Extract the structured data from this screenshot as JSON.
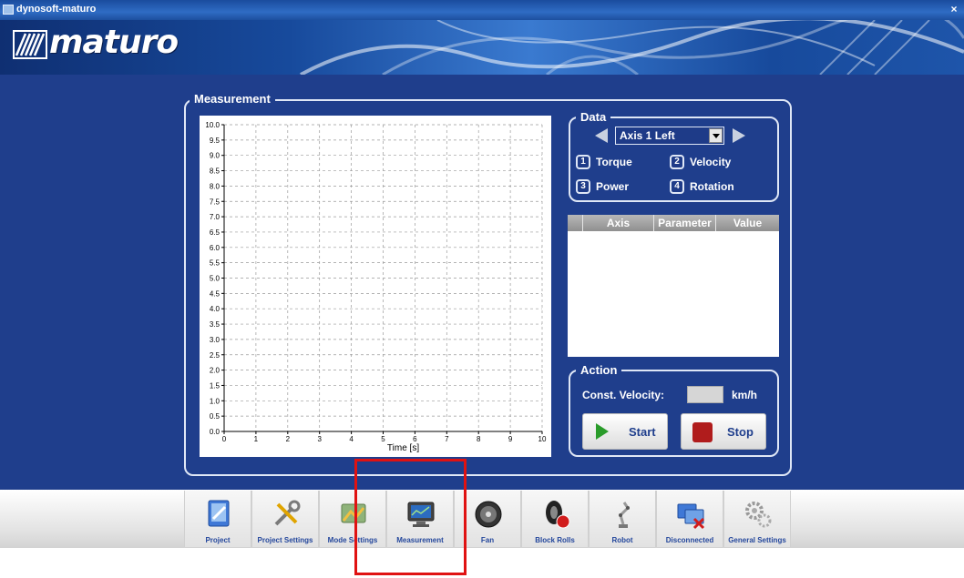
{
  "window": {
    "title": "dynosoft-maturo",
    "close_label": "×"
  },
  "brand": {
    "logo_text": "maturo"
  },
  "measurement": {
    "title": "Measurement",
    "chart_data": {
      "type": "line",
      "title": "",
      "xlabel": "Time [s]",
      "ylabel": "",
      "xlim": [
        0,
        10
      ],
      "ylim": [
        0,
        10
      ],
      "x_ticks": [
        "0",
        "1",
        "2",
        "3",
        "4",
        "5",
        "6",
        "7",
        "8",
        "9",
        "10"
      ],
      "y_ticks": [
        "0.0",
        "0.5",
        "1.0",
        "1.5",
        "2.0",
        "2.5",
        "3.0",
        "3.5",
        "4.0",
        "4.5",
        "5.0",
        "5.5",
        "6.0",
        "6.5",
        "7.0",
        "7.5",
        "8.0",
        "8.5",
        "9.0",
        "9.5",
        "10.0"
      ],
      "grid": true,
      "series": []
    }
  },
  "data_panel": {
    "title": "Data",
    "axis_selected": "Axis 1 Left",
    "params": [
      {
        "num": "1",
        "label": "Torque"
      },
      {
        "num": "2",
        "label": "Velocity"
      },
      {
        "num": "3",
        "label": "Power"
      },
      {
        "num": "4",
        "label": "Rotation"
      }
    ],
    "table_headers": [
      "Axis",
      "Parameter",
      "Value"
    ],
    "table_rows": []
  },
  "action": {
    "title": "Action",
    "velocity_label": "Const. Velocity:",
    "velocity_value": "",
    "velocity_unit": "km/h",
    "start_label": "Start",
    "stop_label": "Stop"
  },
  "toolbar": {
    "items": [
      {
        "label": "Project",
        "icon": "project-icon"
      },
      {
        "label": "Project Settings",
        "icon": "tools-icon"
      },
      {
        "label": "Mode Settings",
        "icon": "mode-settings-icon"
      },
      {
        "label": "Measurement",
        "icon": "monitor-icon"
      },
      {
        "label": "Fan",
        "icon": "fan-icon"
      },
      {
        "label": "Block Rolls",
        "icon": "tire-stop-icon"
      },
      {
        "label": "Robot",
        "icon": "robot-arm-icon"
      },
      {
        "label": "Disconnected",
        "icon": "disconnected-icon"
      },
      {
        "label": "General Settings",
        "icon": "gears-icon"
      }
    ]
  },
  "colors": {
    "background": "#1f3e8c",
    "accent_green": "#2a9c2a",
    "accent_red": "#b01c1c",
    "annotation": "#e01212"
  }
}
